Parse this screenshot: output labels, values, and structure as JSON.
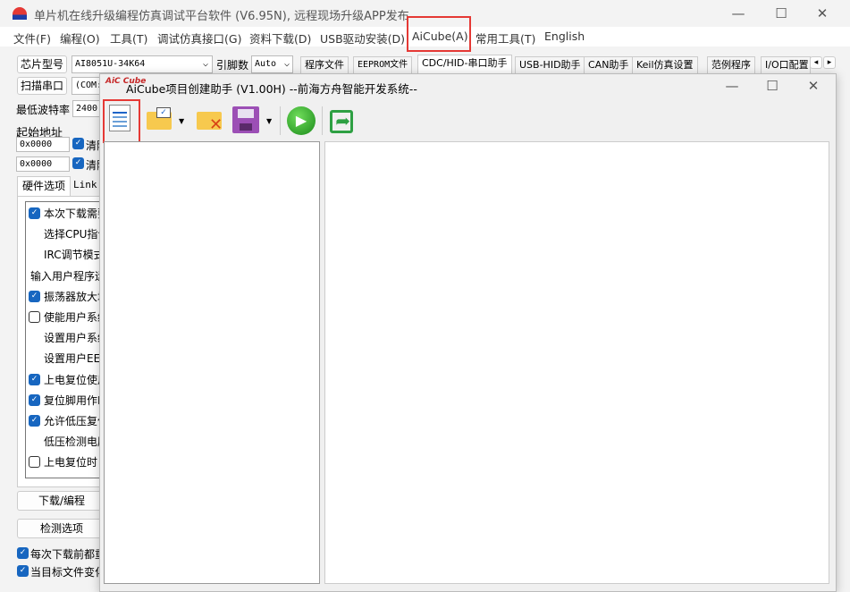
{
  "window": {
    "title": "单片机在线升级编程仿真调试平台软件 (V6.95N), 远程现场升级APP发布",
    "minimize": "—",
    "maximize": "☐",
    "close": "✕"
  },
  "menu": [
    "文件(F)",
    "编程(O)",
    "工具(T)",
    "调试仿真接口(G)",
    "资料下载(D)",
    "USB驱动安装(D)",
    "AiCube(A)",
    "常用工具(T)",
    "English"
  ],
  "toolbar": {
    "chip_label": "芯片型号",
    "chip_value": "AI8051U-34K64",
    "pins_label": "引脚数",
    "pins_value": "Auto",
    "scan_label": "扫描串口",
    "port_value": "(COM:",
    "baud_label": "最低波特率",
    "baud_value": "2400",
    "start_addr_label": "起始地址",
    "addr1": "0x0000",
    "addr2": "0x0000",
    "clear1": "清除",
    "clear2": "清除"
  },
  "tabs": [
    "程序文件",
    "EEPROM文件",
    "CDC/HID-串口助手",
    "USB-HID助手",
    "CAN助手",
    "Keil仿真设置",
    "范例程序",
    "I/O口配置"
  ],
  "tab_scroll": {
    "left": "◂",
    "right": "▸"
  },
  "left_tabs": [
    "硬件选项",
    "Link"
  ],
  "options": [
    {
      "label": "本次下载需要",
      "check": "on"
    },
    {
      "label": "选择CPU指令",
      "check": "none"
    },
    {
      "label": "IRC调节模式",
      "check": "none"
    },
    {
      "label": "输入用户程序运",
      "check": "text"
    },
    {
      "label": "振荡器放大增",
      "check": "on"
    },
    {
      "label": "使能用户系统",
      "check": "off"
    },
    {
      "label": "设置用户系统",
      "check": "none"
    },
    {
      "label": "设置用户EEP",
      "check": "none"
    },
    {
      "label": "上电复位使用",
      "check": "on"
    },
    {
      "label": "复位脚用作I",
      "check": "on"
    },
    {
      "label": "允许低压复位",
      "check": "on"
    },
    {
      "label": "低压检测电压",
      "check": "none"
    },
    {
      "label": "上电复位时",
      "check": "off"
    }
  ],
  "buttons": {
    "download": "下载/编程",
    "check": "检测选项"
  },
  "bottom_checks": [
    "每次下载前都重",
    "当目标文件变化"
  ],
  "dialog": {
    "logo": "AiC Cube",
    "title": "AiCube项目创建助手 (V1.00H) --前海方舟智能开发系统--",
    "minimize": "—",
    "maximize": "☐",
    "close": "✕"
  },
  "colors": {
    "highlight": "#e53935",
    "checkbox": "#1766c0"
  }
}
